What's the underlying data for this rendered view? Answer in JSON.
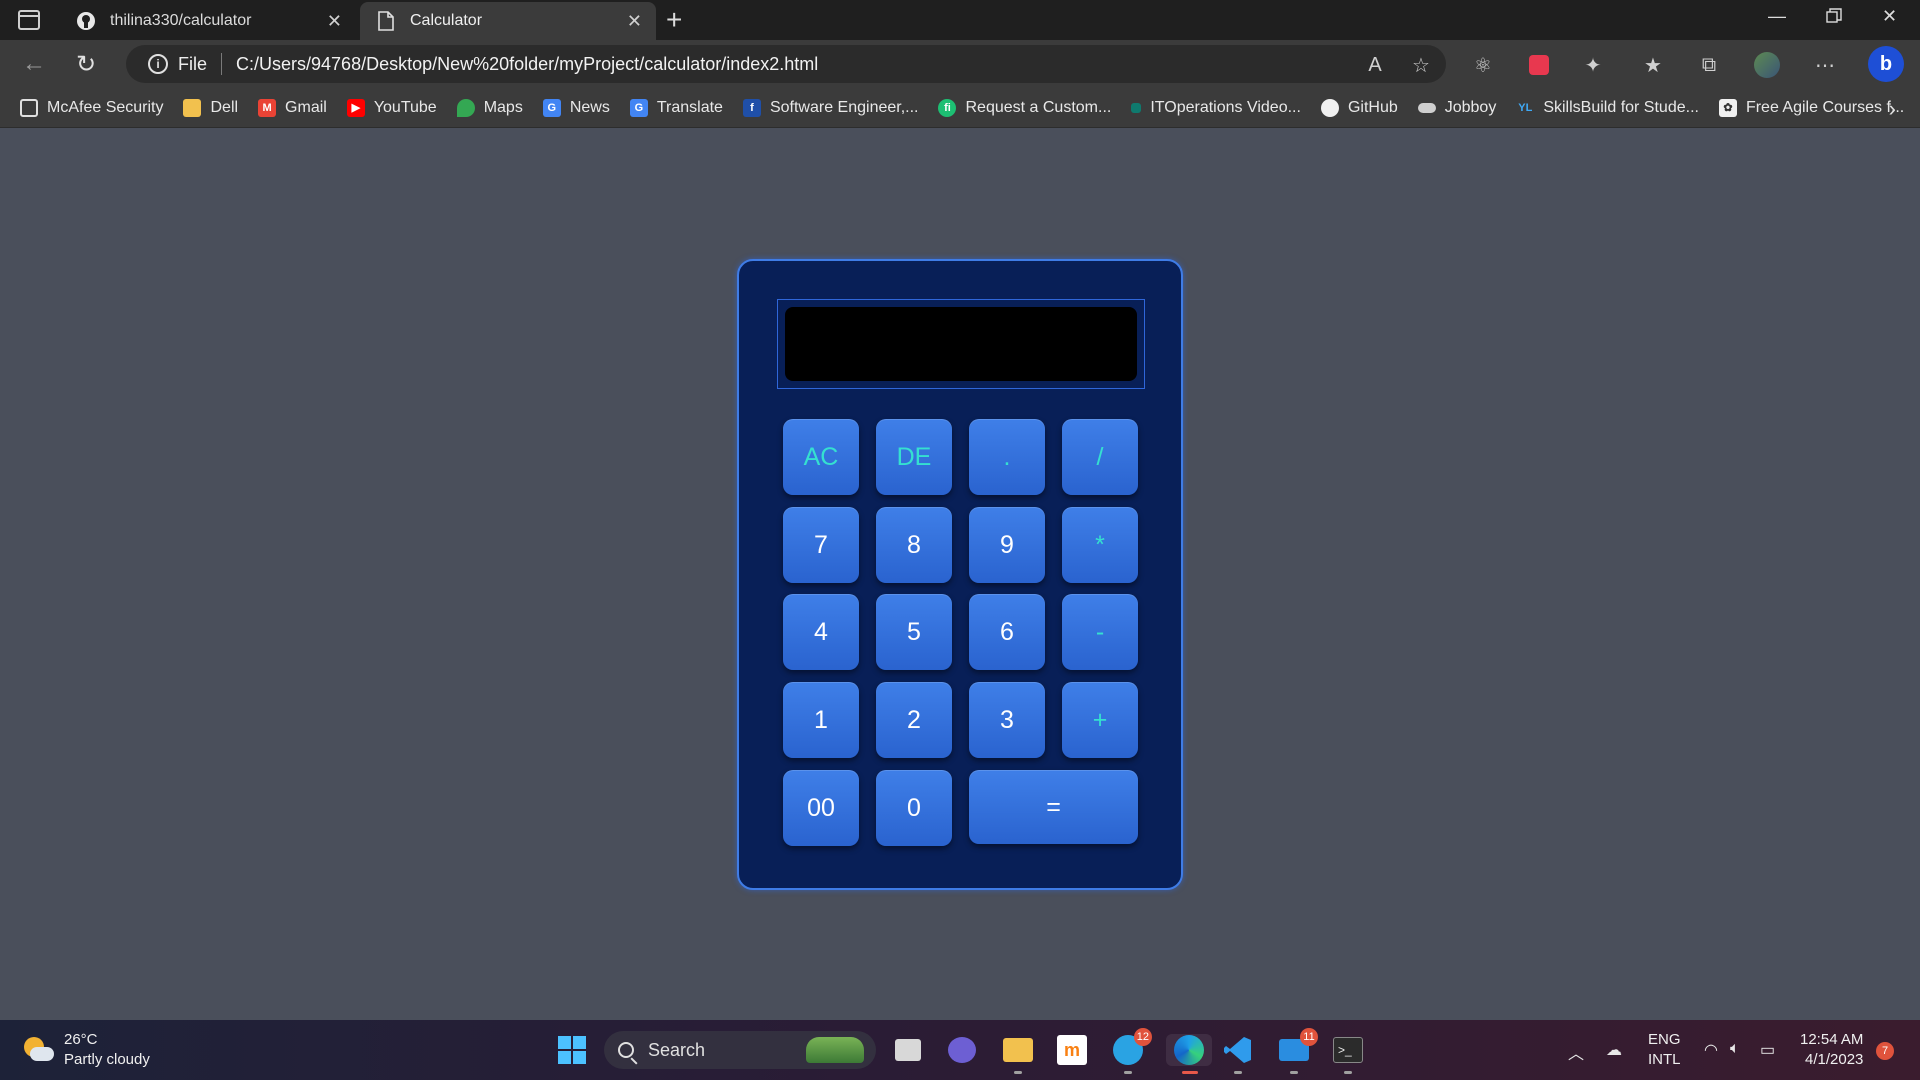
{
  "browser": {
    "tabs": [
      {
        "title": "thilina330/calculator",
        "icon": "github-icon",
        "active": false
      },
      {
        "title": "Calculator",
        "icon": "page-icon",
        "active": true
      }
    ],
    "file_label": "File",
    "url": "C:/Users/94768/Desktop/New%20folder/myProject/calculator/index2.html"
  },
  "bookmarks": [
    {
      "label": "McAfee Security",
      "icon": "page-icon",
      "color": "#3b3b3b"
    },
    {
      "label": "Dell",
      "icon": "folder-icon",
      "color": "#f2c14e"
    },
    {
      "label": "Gmail",
      "icon": "gmail-icon",
      "color": "#ea4335"
    },
    {
      "label": "YouTube",
      "icon": "youtube-icon",
      "color": "#ff0000"
    },
    {
      "label": "Maps",
      "icon": "maps-icon",
      "color": "#34a853"
    },
    {
      "label": "News",
      "icon": "news-icon",
      "color": "#4285f4"
    },
    {
      "label": "Translate",
      "icon": "translate-icon",
      "color": "#4285f4"
    },
    {
      "label": "Software Engineer,...",
      "icon": "fiverr-f-icon",
      "color": "#1f4fa8"
    },
    {
      "label": "Request a Custom...",
      "icon": "fiverr-icon",
      "color": "#1dbf73"
    },
    {
      "label": "ITOperations Video...",
      "icon": "it-icon",
      "color": "#0f7a6e"
    },
    {
      "label": "GitHub",
      "icon": "github-icon",
      "color": "#ffffff"
    },
    {
      "label": "Jobboy",
      "icon": "jobboy-icon",
      "color": "#cfcfcf"
    },
    {
      "label": "SkillsBuild for Stude...",
      "icon": "skillsbuild-icon",
      "color": "#0f62fe"
    },
    {
      "label": "Free Agile Courses f...",
      "icon": "agile-icon",
      "color": "#ffffff"
    }
  ],
  "calculator": {
    "display_value": "",
    "keys": [
      "AC",
      "DE",
      ".",
      "/",
      "7",
      "8",
      "9",
      "*",
      "4",
      "5",
      "6",
      "-",
      "1",
      "2",
      "3",
      "+",
      "00",
      "0",
      "="
    ],
    "colors": {
      "body": "#081f57",
      "key": "#3472e0",
      "operator_text": "#35e0d0",
      "display": "#000000"
    }
  },
  "taskbar": {
    "weather_temp": "26°C",
    "weather_desc": "Partly cloudy",
    "search_label": "Search",
    "telegram_badge": "12",
    "mail_badge": "11",
    "language": "ENG",
    "input_mode": "INTL",
    "time": "12:54 AM",
    "date": "4/1/2023",
    "notification_count": "7"
  }
}
